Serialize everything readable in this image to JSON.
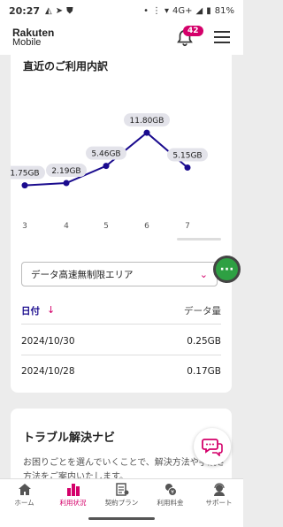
{
  "status": {
    "time": "20:27",
    "network": "4G+",
    "battery": "81%"
  },
  "header": {
    "logo_line1": "Rakuten",
    "logo_line2": "Mobile",
    "notification_count": "42"
  },
  "usage": {
    "title": "直近のご利用内訳",
    "select_value": "データ高速無制限エリア",
    "col_date": "日付",
    "col_amount": "データ量",
    "rows": [
      {
        "date": "2024/10/30",
        "amount": "0.25GB"
      },
      {
        "date": "2024/10/28",
        "amount": "0.17GB"
      }
    ]
  },
  "chart_data": {
    "type": "line",
    "x": [
      "3",
      "4",
      "5",
      "6",
      "7"
    ],
    "values": [
      1.75,
      2.19,
      5.46,
      11.8,
      5.15
    ],
    "labels": [
      "1.75GB",
      "2.19GB",
      "5.46GB",
      "11.80GB",
      "5.15GB"
    ],
    "ylim": [
      0,
      13
    ],
    "color": "#1a0b8e"
  },
  "trouble": {
    "title": "トラブル解決ナビ",
    "desc": "お困りごとを選んでいくことで、解決方法や手続き方法をご案内いたします。"
  },
  "nav": [
    {
      "label": "ホーム",
      "icon": "home-icon"
    },
    {
      "label": "利用状況",
      "icon": "bar-chart-icon"
    },
    {
      "label": "契約プラン",
      "icon": "contract-icon"
    },
    {
      "label": "利用料金",
      "icon": "fee-icon"
    },
    {
      "label": "サポート",
      "icon": "support-icon"
    }
  ],
  "colors": {
    "accent": "#d4006a",
    "navy": "#1a0b8e",
    "green": "#2ea043"
  }
}
